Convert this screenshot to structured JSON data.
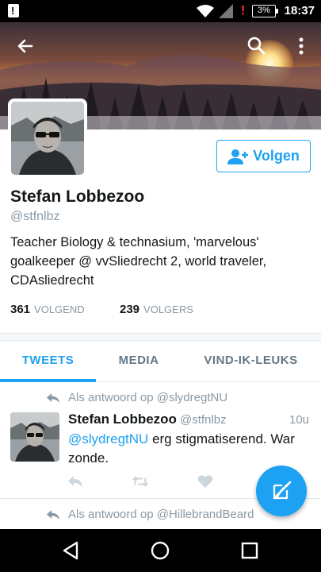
{
  "status_bar": {
    "battery_percent": "3%",
    "time": "18:37",
    "icons": [
      "notification-alert-icon",
      "wifi-icon",
      "signal-icon",
      "battery-alert-icon"
    ]
  },
  "header": {
    "icons": [
      "back-arrow-icon",
      "search-icon",
      "more-vertical-icon"
    ]
  },
  "profile": {
    "name": "Stefan Lobbezoo",
    "handle": "@stfnlbz",
    "bio": "Teacher Biology & technasium, 'marvelous' goalkeeper  @ vvSliedrecht 2, world traveler, CDAsliedrecht",
    "follow_label": "Volgen",
    "following_count": "361",
    "following_label": "VOLGEND",
    "followers_count": "239",
    "followers_label": "VOLGERS"
  },
  "tabs": [
    {
      "label": "TWEETS",
      "active": true
    },
    {
      "label": "MEDIA",
      "active": false
    },
    {
      "label": "VIND-IK-LEUKS",
      "active": false
    }
  ],
  "tweets": [
    {
      "reply_context": "Als antwoord op @slydregtNU",
      "author": "Stefan Lobbezoo",
      "handle": "@stfnlbz",
      "time": "10u",
      "mention": "@slydregtNU",
      "text": " erg stigmatiserend. War zonde."
    },
    {
      "reply_context": "Als antwoord op @HillebrandBeard"
    }
  ],
  "colors": {
    "accent": "#1da1f2",
    "muted": "#8899a6",
    "text": "#14171a"
  }
}
